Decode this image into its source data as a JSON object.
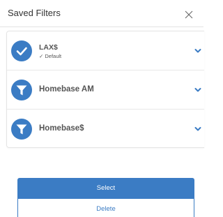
{
  "header": {
    "title": "Saved Filters",
    "close_icon": "close-icon"
  },
  "colors": {
    "accent": "#3b7cc4",
    "text": "#555555",
    "border": "#e4e4e4"
  },
  "filters": [
    {
      "label": "LAX$",
      "sublabel": "✓ Default",
      "icon": "check-icon",
      "is_default": true
    },
    {
      "label": "Homebase AM",
      "icon": "funnel-icon",
      "is_default": false
    },
    {
      "label": "Homebase$",
      "icon": "funnel-icon",
      "is_default": false
    }
  ],
  "actions": {
    "select_label": "Select",
    "delete_label": "Delete"
  }
}
